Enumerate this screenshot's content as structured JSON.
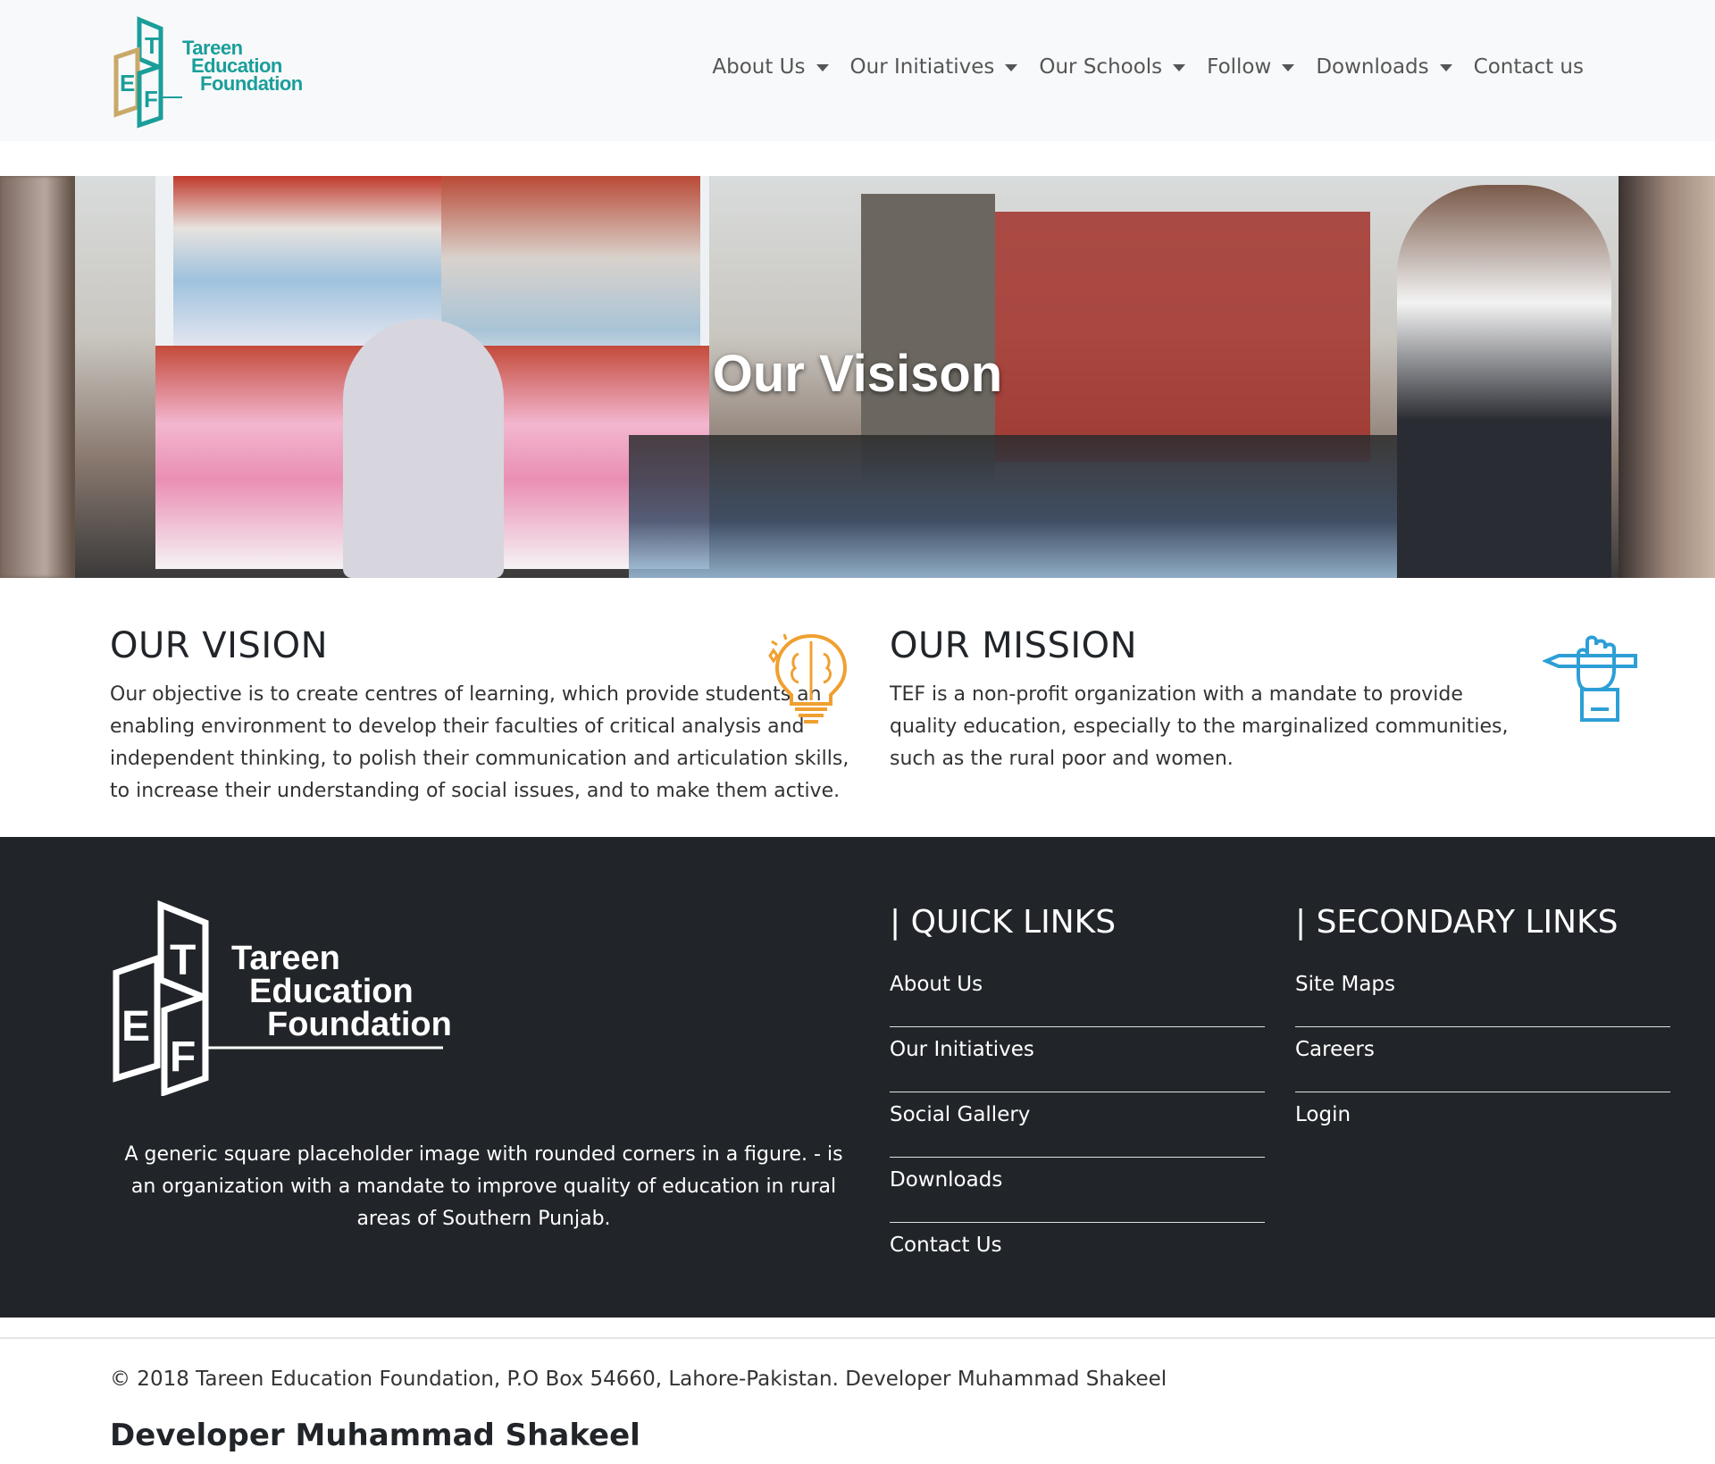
{
  "brand": {
    "line1": "Tareen",
    "line2": "Education",
    "line3": "Foundation",
    "letters": [
      "T",
      "E",
      "F"
    ],
    "accent": "#1a9e9a",
    "accent2": "#c9a96a"
  },
  "nav": [
    {
      "label": "About Us",
      "dropdown": true
    },
    {
      "label": "Our Initiatives",
      "dropdown": true
    },
    {
      "label": "Our Schools",
      "dropdown": true
    },
    {
      "label": "Follow",
      "dropdown": true
    },
    {
      "label": "Downloads",
      "dropdown": true
    },
    {
      "label": "Contact us",
      "dropdown": false
    }
  ],
  "hero": {
    "title": "Our Visison"
  },
  "vision": {
    "heading": "OUR VISION",
    "text": "Our objective is to create centres of learning, which provide students an enabling environment to develop their faculties of critical analysis and independent thinking, to polish their communication and articulation skills, to increase their understanding of social issues, and to make them active.",
    "icon": "brain-lightbulb-icon",
    "icon_color": "#f0a030"
  },
  "mission": {
    "heading": "OUR MISSION",
    "text": "TEF is a non-profit organization with a mandate to provide quality education, especially to the marginalized communities, such as the rural poor and women.",
    "icon": "hand-pen-icon",
    "icon_color": "#2d9fd6"
  },
  "footer": {
    "description": "A generic square placeholder image with rounded corners in a figure. - is an organization with a mandate to improve quality of education in rural areas of Southern Punjab.",
    "quick_links": {
      "heading": "| QUICK LINKS",
      "items": [
        "About Us",
        "Our Initiatives",
        "Social Gallery",
        "Downloads",
        "Contact Us"
      ]
    },
    "secondary_links": {
      "heading": "| SECONDARY LINKS",
      "items": [
        "Site Maps",
        "Careers",
        "Login"
      ]
    },
    "bg": "#212529"
  },
  "bottom": {
    "copyright": "© 2018 Tareen Education Foundation, P.O Box 54660, Lahore-Pakistan. Developer Muhammad Shakeel",
    "developer": "Developer Muhammad Shakeel"
  }
}
